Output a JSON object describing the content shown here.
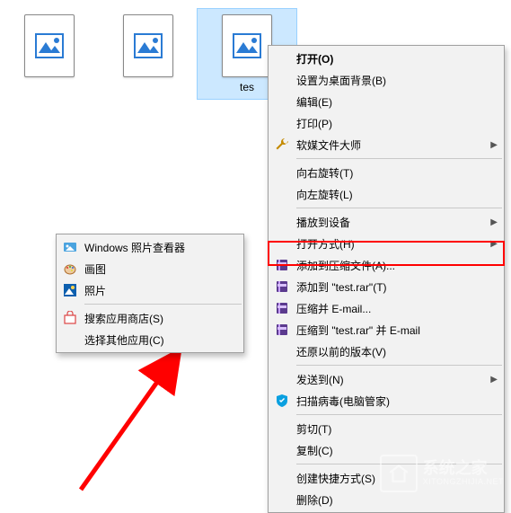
{
  "files": [
    {
      "label": ""
    },
    {
      "label": ""
    },
    {
      "label": "tes",
      "selected": true
    }
  ],
  "left_crop_char": ";",
  "main_menu": {
    "groups": [
      [
        {
          "label": "打开(O)",
          "bold": true
        },
        {
          "label": "设置为桌面背景(B)"
        },
        {
          "label": "编辑(E)"
        },
        {
          "label": "打印(P)"
        },
        {
          "label": "软媒文件大师",
          "icon": "wrench",
          "arrow": true
        }
      ],
      [
        {
          "label": "向右旋转(T)"
        },
        {
          "label": "向左旋转(L)"
        }
      ],
      [
        {
          "label": "播放到设备",
          "arrow": true
        },
        {
          "label": "打开方式(H)",
          "arrow": true,
          "highlight": true
        },
        {
          "label": "添加到压缩文件(A)...",
          "icon": "rar"
        },
        {
          "label": "添加到 \"test.rar\"(T)",
          "icon": "rar"
        },
        {
          "label": "压缩并 E-mail...",
          "icon": "rar"
        },
        {
          "label": "压缩到 \"test.rar\" 并 E-mail",
          "icon": "rar"
        },
        {
          "label": "还原以前的版本(V)"
        }
      ],
      [
        {
          "label": "发送到(N)",
          "arrow": true
        },
        {
          "label": "扫描病毒(电脑管家)",
          "icon": "shield"
        }
      ],
      [
        {
          "label": "剪切(T)"
        },
        {
          "label": "复制(C)"
        }
      ],
      [
        {
          "label": "创建快捷方式(S)"
        },
        {
          "label": "删除(D)"
        }
      ]
    ]
  },
  "sub_menu": {
    "items": [
      {
        "label": "Windows 照片查看器",
        "icon": "photoviewer"
      },
      {
        "label": "画图",
        "icon": "paint"
      },
      {
        "label": "照片",
        "icon": "photos"
      }
    ],
    "footer": [
      {
        "label": "搜索应用商店(S)",
        "icon": "store"
      },
      {
        "label": "选择其他应用(C)",
        "highlight": true
      }
    ]
  },
  "watermark": {
    "title": "系统之家",
    "sub": "XITONGZHIJIA.NET"
  }
}
